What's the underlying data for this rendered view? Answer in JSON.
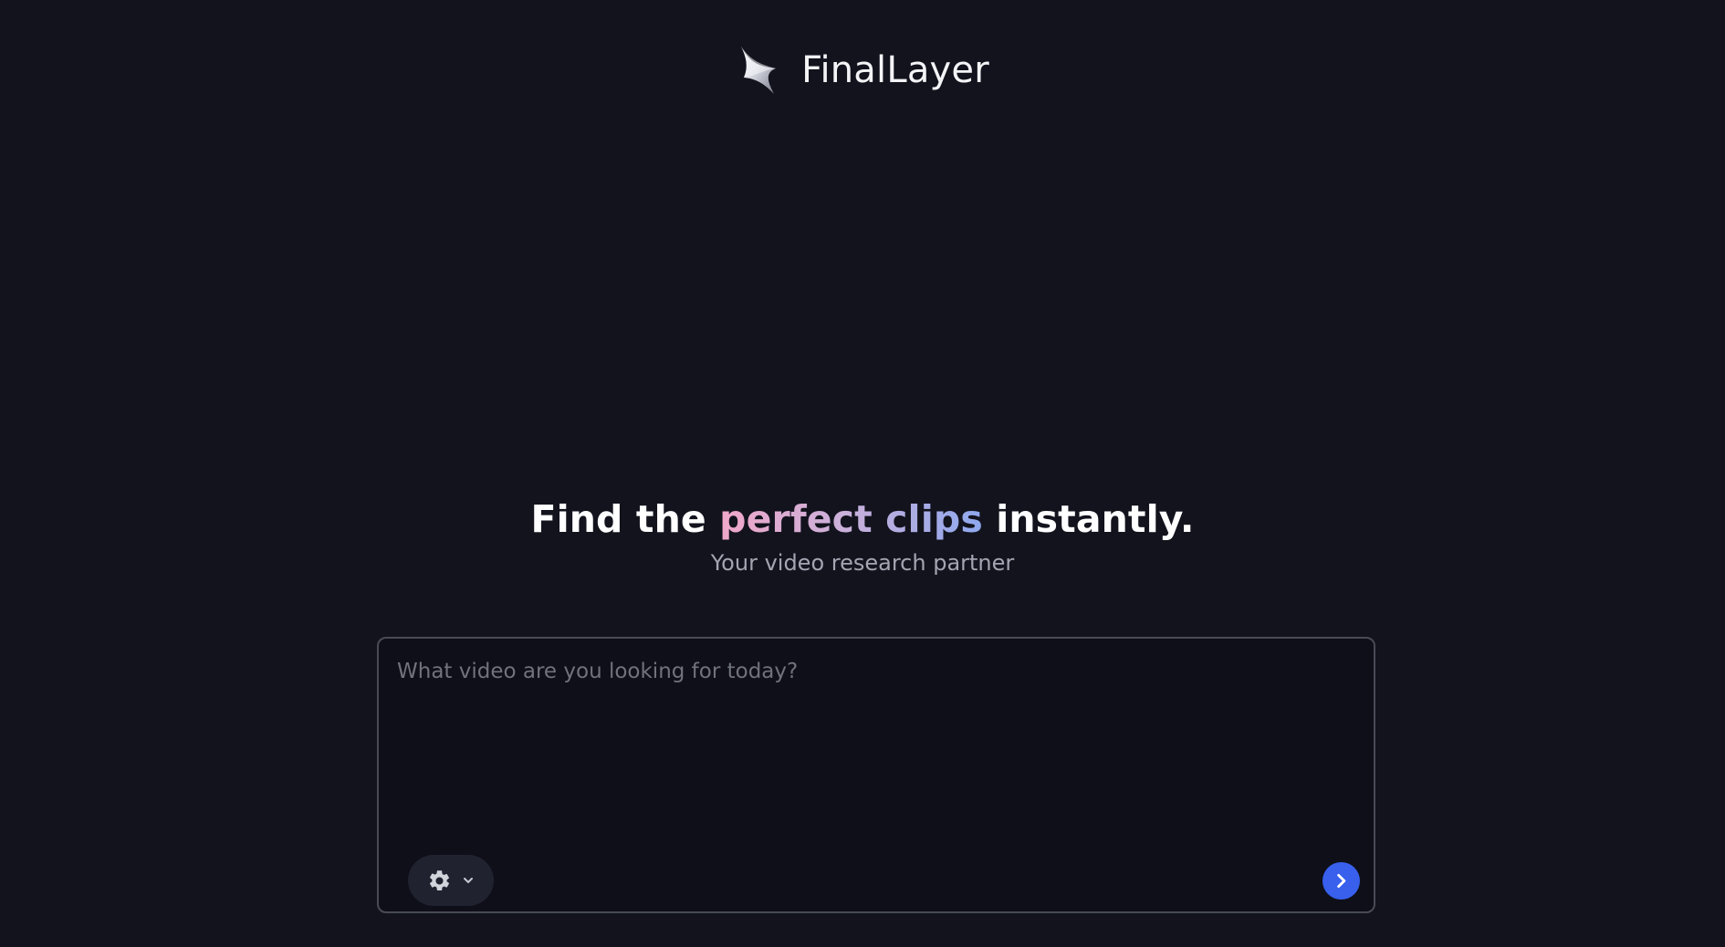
{
  "brand": {
    "name": "FinalLayer"
  },
  "hero": {
    "title_prefix": "Find the",
    "title_highlight": "perfect clips",
    "title_suffix": "instantly.",
    "subtitle": "Your video research partner"
  },
  "prompt": {
    "placeholder": "What video are you looking for today?",
    "value": ""
  },
  "icons": {
    "brand_logo": "star-logo-icon",
    "settings": "gear-icon",
    "settings_menu": "chevron-down-icon",
    "submit": "chevron-right-icon"
  },
  "colors": {
    "background": "#12131d",
    "input_background": "#0e0f18",
    "input_border": "#484a55",
    "highlight_start": "#f0a7c9",
    "highlight_end": "#8ea8ee",
    "submit_button": "#3860ed"
  }
}
